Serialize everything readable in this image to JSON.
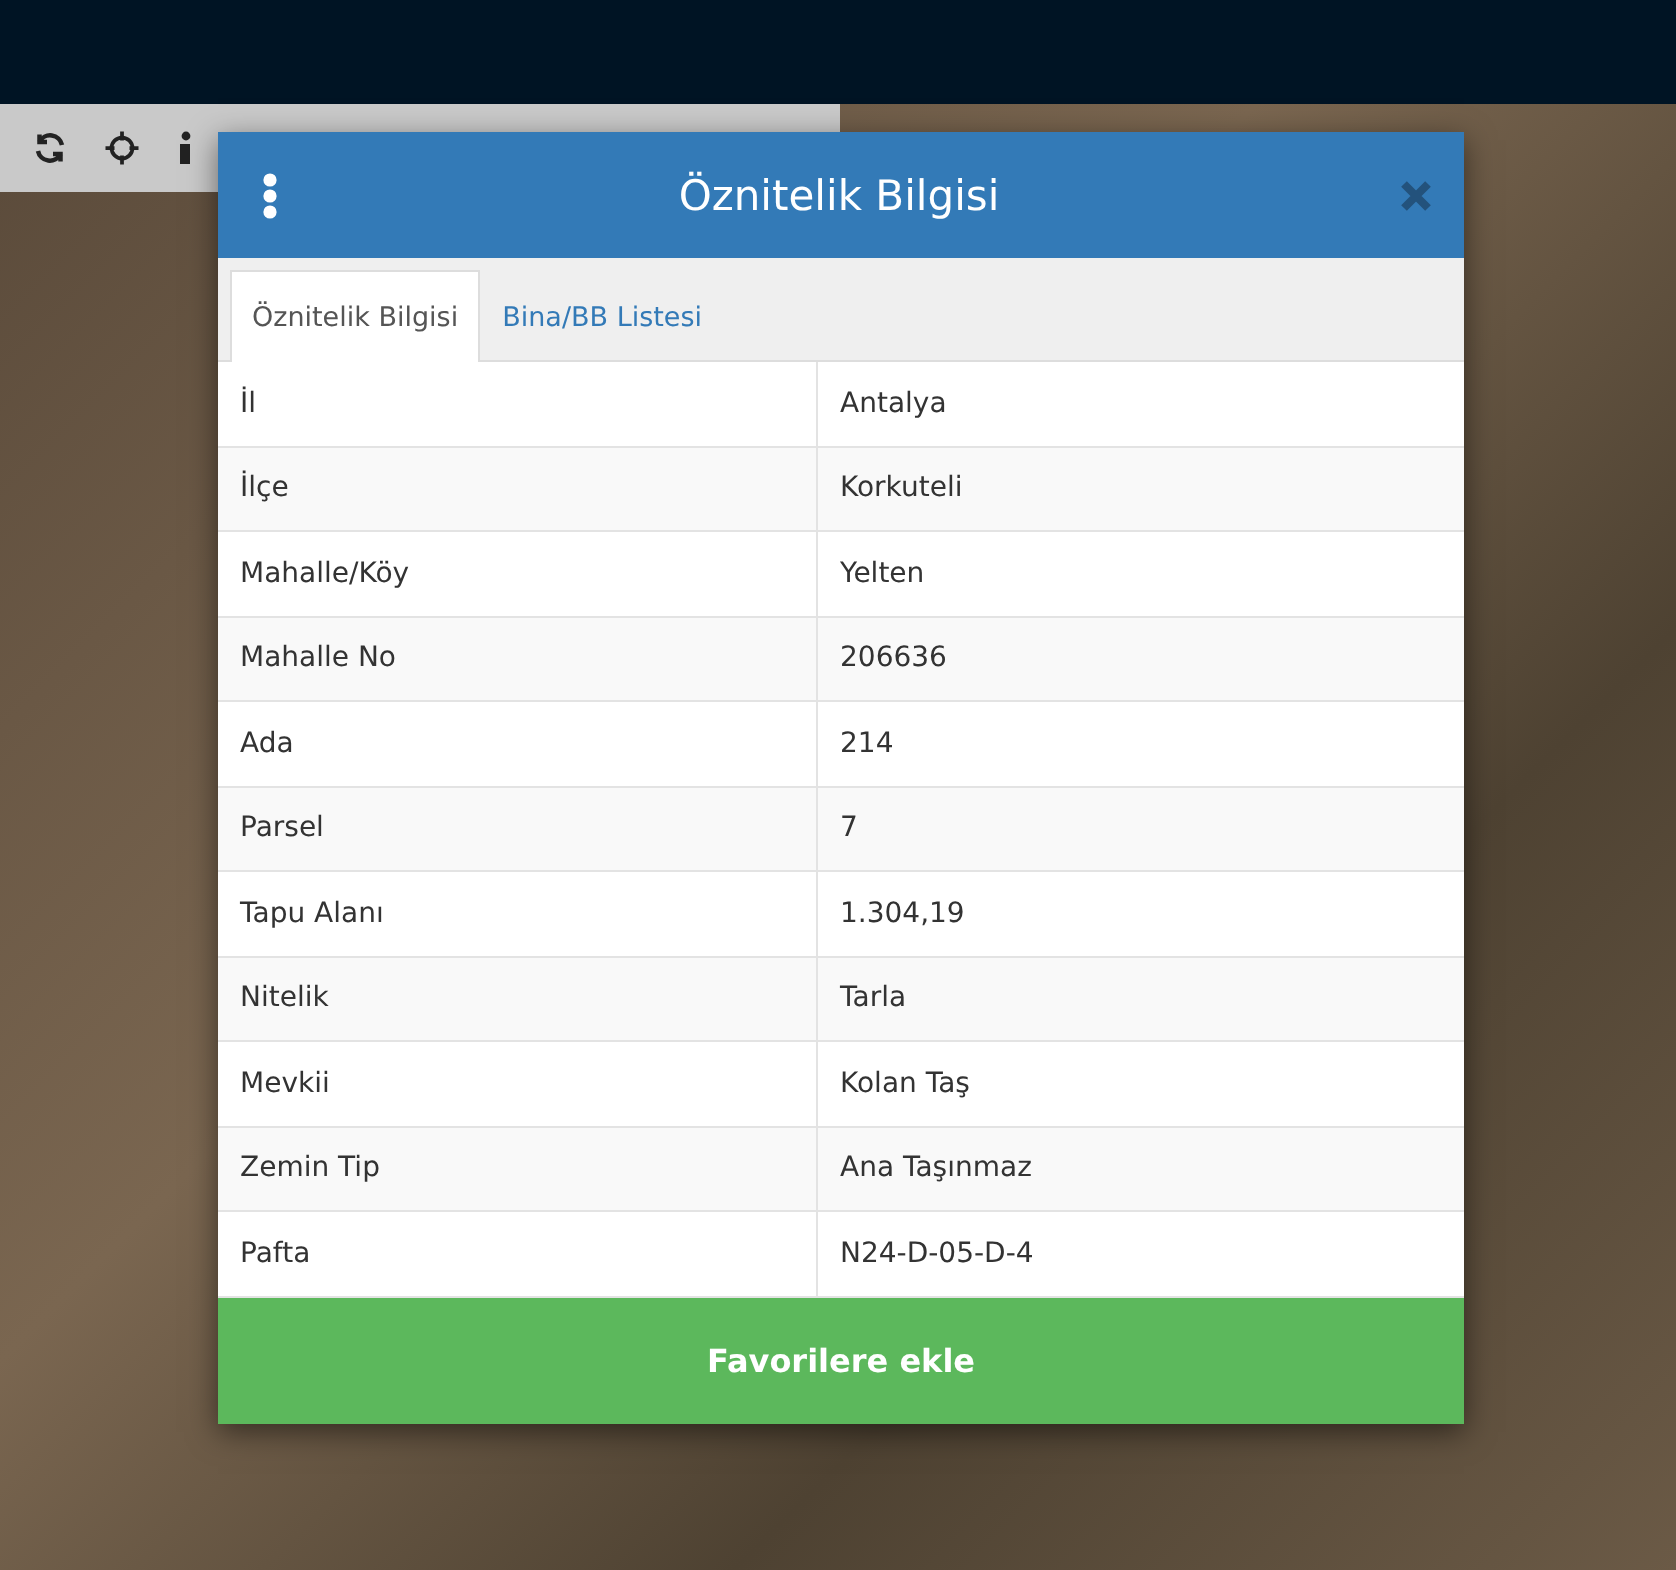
{
  "dialog": {
    "title": "Öznitelik Bilgisi",
    "tabs": [
      {
        "label": "Öznitelik Bilgisi",
        "selected": true
      },
      {
        "label": "Bina/BB Listesi",
        "selected": false
      }
    ],
    "rows": [
      {
        "label": "İl",
        "value": "Antalya"
      },
      {
        "label": "İlçe",
        "value": "Korkuteli"
      },
      {
        "label": "Mahalle/Köy",
        "value": "Yelten"
      },
      {
        "label": "Mahalle No",
        "value": "206636"
      },
      {
        "label": "Ada",
        "value": "214"
      },
      {
        "label": "Parsel",
        "value": "7"
      },
      {
        "label": "Tapu Alanı",
        "value": "1.304,19"
      },
      {
        "label": "Nitelik",
        "value": "Tarla"
      },
      {
        "label": "Mevkii",
        "value": "Kolan Taş"
      },
      {
        "label": "Zemin Tip",
        "value": "Ana Taşınmaz"
      },
      {
        "label": "Pafta",
        "value": "N24-D-05-D-4"
      }
    ],
    "button": "Favorilere ekle"
  }
}
